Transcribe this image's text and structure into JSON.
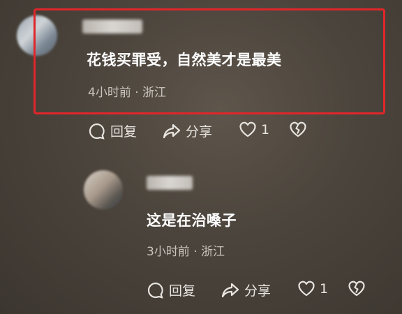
{
  "comments": [
    {
      "text": "花钱买罪受，自然美才是最美",
      "meta": "4小时前 · 浙江",
      "actions": {
        "reply": "回复",
        "share": "分享",
        "likes": "1"
      }
    },
    {
      "text": "这是在治嗓子",
      "meta": "3小时前 · 浙江",
      "actions": {
        "reply": "回复",
        "share": "分享",
        "likes": "1"
      }
    }
  ]
}
